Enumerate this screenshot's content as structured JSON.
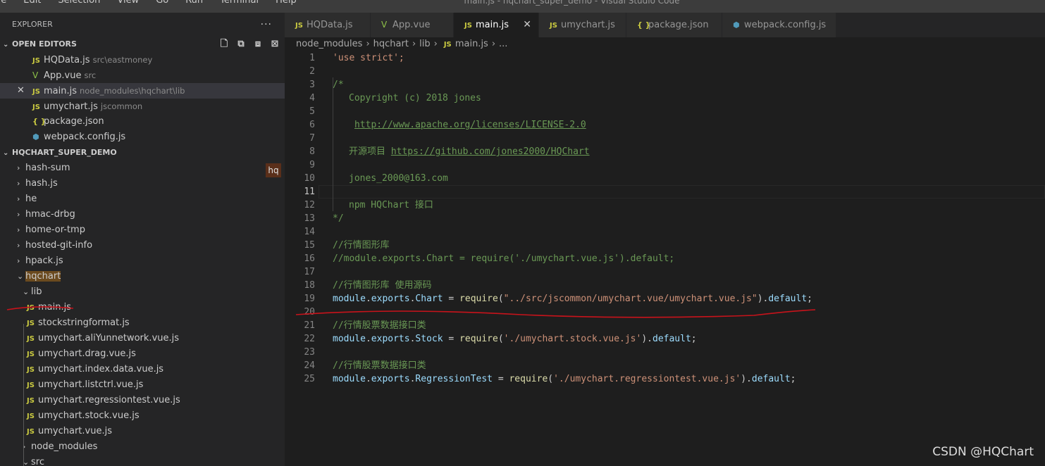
{
  "menu": [
    "ile",
    "Edit",
    "Selection",
    "View",
    "Go",
    "Run",
    "Terminal",
    "Help"
  ],
  "window_title": "main.js - hqchart_super_demo - Visual Studio Code",
  "sidebar": {
    "header": "EXPLORER",
    "more": "···",
    "open_editors": {
      "title": "OPEN EDITORS",
      "items": [
        {
          "name": "HQData.js",
          "desc": "src\\eastmoney",
          "icon": "JS"
        },
        {
          "name": "App.vue",
          "desc": "src",
          "icon": "V"
        },
        {
          "name": "main.js",
          "desc": "node_modules\\hqchart\\lib",
          "icon": "JS"
        },
        {
          "name": "umychart.js",
          "desc": "jscommon",
          "icon": "JS"
        },
        {
          "name": "package.json",
          "desc": "",
          "icon": "{ }"
        },
        {
          "name": "webpack.config.js",
          "desc": "",
          "icon": "wp"
        }
      ]
    },
    "project": {
      "title": "HQCHART_SUPER_DEMO",
      "badge": "hq",
      "items": [
        {
          "label": "hash-sum",
          "chev": "›"
        },
        {
          "label": "hash.js",
          "chev": "›"
        },
        {
          "label": "he",
          "chev": "›"
        },
        {
          "label": "hmac-drbg",
          "chev": "›"
        },
        {
          "label": "home-or-tmp",
          "chev": "›"
        },
        {
          "label": "hosted-git-info",
          "chev": "›"
        },
        {
          "label": "hpack.js",
          "chev": "›"
        },
        {
          "label": "hqchart",
          "chev": "⌄"
        },
        {
          "label": "lib",
          "chev": "⌄"
        },
        {
          "label": "main.js",
          "icon": "JS"
        },
        {
          "label": "stockstringformat.js",
          "icon": "JS"
        },
        {
          "label": "umychart.aliYunnetwork.vue.js",
          "icon": "JS"
        },
        {
          "label": "umychart.drag.vue.js",
          "icon": "JS"
        },
        {
          "label": "umychart.index.data.vue.js",
          "icon": "JS"
        },
        {
          "label": "umychart.listctrl.vue.js",
          "icon": "JS"
        },
        {
          "label": "umychart.regressiontest.vue.js",
          "icon": "JS"
        },
        {
          "label": "umychart.stock.vue.js",
          "icon": "JS"
        },
        {
          "label": "umychart.vue.js",
          "icon": "JS"
        },
        {
          "label": "node_modules",
          "chev": "›"
        },
        {
          "label": "src",
          "chev": "⌄"
        }
      ]
    }
  },
  "tabs": [
    {
      "label": "HQData.js",
      "icon": "JS"
    },
    {
      "label": "App.vue",
      "icon": "V"
    },
    {
      "label": "main.js",
      "icon": "JS",
      "close": "✕"
    },
    {
      "label": "umychart.js",
      "icon": "JS"
    },
    {
      "label": "package.json",
      "icon": "{ }"
    },
    {
      "label": "webpack.config.js",
      "icon": "wp"
    }
  ],
  "breadcrumb": [
    "node_modules",
    "hqchart",
    "lib",
    "main.js",
    "..."
  ],
  "breadcrumb_icon": "JS",
  "code": {
    "l1": "'use strict';",
    "l3": "/*",
    "l4": "Copyright (c) 2018 jones",
    "l6": "http://www.apache.org/licenses/LICENSE-2.0",
    "l8_a": "开源项目 ",
    "l8_b": "https://github.com/jones2000/HQChart",
    "l10": "jones_2000@163.com",
    "l12": "npm HQChart 接口",
    "l13": "*/",
    "l15": "//行情图形库",
    "l16": "//module.exports.Chart = require('./umychart.vue.js').default;",
    "l18": "//行情图形库 使用源码",
    "l19": {
      "a": "module",
      "b": ".",
      "c": "exports",
      "d": ".",
      "e": "Chart",
      "f": " = ",
      "g": "require",
      "h": "(",
      "i": "\"../src/jscommon/umychart.vue/umychart.vue.js\"",
      "j": ").",
      "k": "default",
      "l": ";"
    },
    "l21": "//行情股票数据接口类",
    "l22": {
      "a": "module",
      "b": ".",
      "c": "exports",
      "d": ".",
      "e": "Stock",
      "f": " = ",
      "g": "require",
      "h": "(",
      "i": "'./umychart.stock.vue.js'",
      "j": ").",
      "k": "default",
      "l": ";"
    },
    "l24": "//行情股票数据接口类",
    "l25": {
      "a": "module",
      "b": ".",
      "c": "exports",
      "d": ".",
      "e": "RegressionTest",
      "f": " = ",
      "g": "require",
      "h": "(",
      "i": "'./umychart.regressiontest.vue.js'",
      "j": ").",
      "k": "default",
      "l": ";"
    }
  },
  "line_numbers": [
    "1",
    "2",
    "3",
    "4",
    "5",
    "6",
    "7",
    "8",
    "9",
    "10",
    "11",
    "12",
    "13",
    "14",
    "15",
    "16",
    "17",
    "18",
    "19",
    "20",
    "21",
    "22",
    "23",
    "24",
    "25"
  ],
  "watermark": "CSDN @HQChart",
  "colors": {
    "annotation": "#c8131b",
    "accent_js": "#cbcb41"
  }
}
